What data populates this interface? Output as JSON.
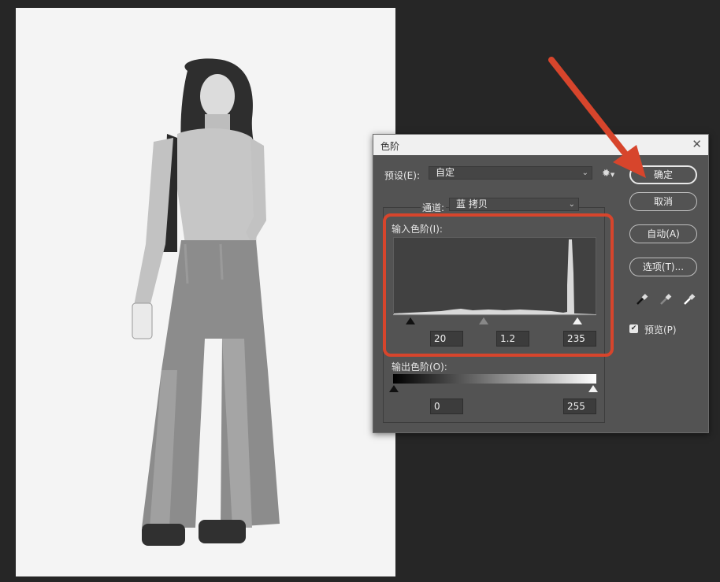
{
  "dialog": {
    "title": "色阶",
    "close_glyph": "✕",
    "preset_label": "预设(E):",
    "preset_value": "自定",
    "channel_label": "通道:",
    "channel_value": "蓝 拷贝",
    "input_levels_label": "输入色阶(I):",
    "input_black": "20",
    "input_gamma": "1.2",
    "input_white": "235",
    "output_levels_label": "输出色阶(O):",
    "output_black": "0",
    "output_white": "255",
    "buttons": {
      "ok": "确定",
      "cancel": "取消",
      "auto": "自动(A)",
      "options": "选项(T)..."
    },
    "preview_label": "预览(P)",
    "preview_checked": true
  },
  "icons": {
    "gear": "gear-icon",
    "eyedropper_black": "eyedropper-black-icon",
    "eyedropper_gray": "eyedropper-gray-icon",
    "eyedropper_white": "eyedropper-white-icon"
  },
  "colors": {
    "annotation": "#d7452c",
    "dialog_bg": "#535353",
    "workspace_bg": "#262626"
  }
}
